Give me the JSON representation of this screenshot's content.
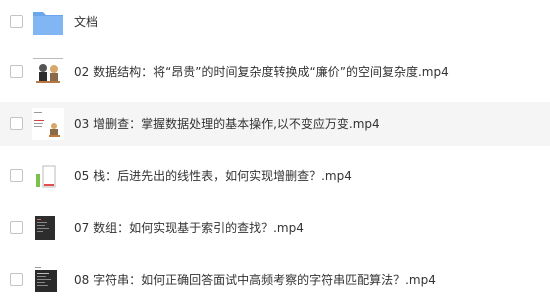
{
  "colors": {
    "folder": "#7fb6f3",
    "folder_tab": "#6aa6ec",
    "selected_row_bg": "#f5f5f5",
    "text": "#333333",
    "checkbox_border": "#c4c4c4"
  },
  "files": [
    {
      "name": "文档",
      "icon": "folder-icon",
      "type": "folder",
      "selected": false
    },
    {
      "name": "02 数据结构：将“昂贵”的时间复杂度转换成“廉价”的空间复杂度.mp4",
      "icon": "video-thumbnail-icon",
      "type": "video",
      "selected": false
    },
    {
      "name": "03 增删查：掌握数据处理的基本操作,以不变应万变.mp4",
      "icon": "video-thumbnail-icon",
      "type": "video",
      "selected": true
    },
    {
      "name": "05 栈：后进先出的线性表，如何实现增删查？.mp4",
      "icon": "video-thumbnail-icon",
      "type": "video",
      "selected": false
    },
    {
      "name": "07 数组：如何实现基于索引的查找？.mp4",
      "icon": "video-thumbnail-icon",
      "type": "video",
      "selected": false
    },
    {
      "name": "08 字符串：如何正确回答面试中高频考察的字符串匹配算法？.mp4",
      "icon": "video-thumbnail-icon",
      "type": "video",
      "selected": false
    }
  ]
}
